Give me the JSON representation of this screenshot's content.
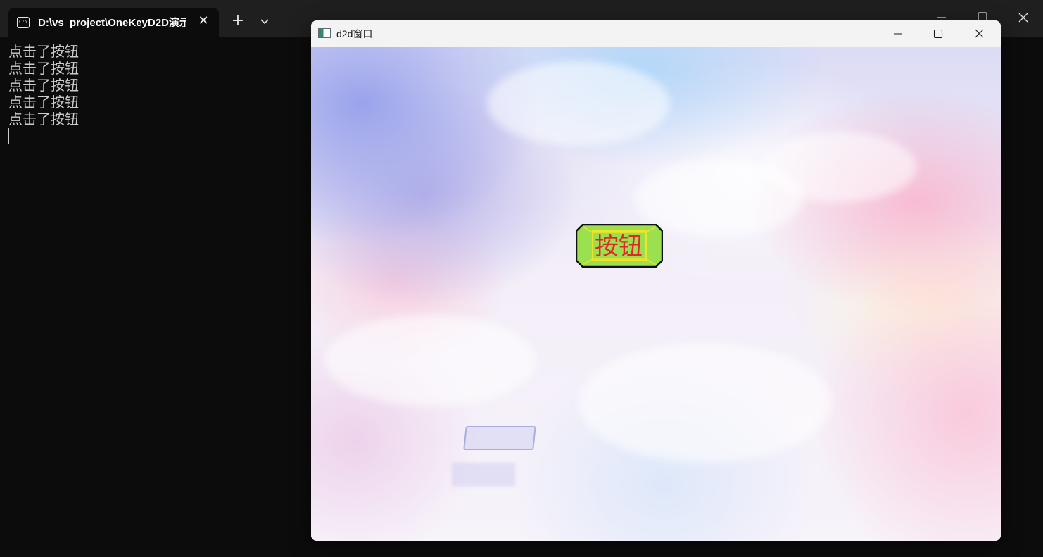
{
  "terminal": {
    "tab": {
      "title": "D:\\vs_project\\OneKeyD2D演示",
      "icon": "cmd-icon"
    },
    "new_tab_icon": "plus-icon",
    "dropdown_icon": "chevron-down-icon",
    "output_lines": [
      "点击了按钮",
      "点击了按钮",
      "点击了按钮",
      "点击了按钮",
      "点击了按钮"
    ]
  },
  "d2d_window": {
    "title": "d2d窗口",
    "button": {
      "label": "按钮",
      "fill_color": "#9be04f",
      "border_color": "#111111",
      "text_color": "#e02828",
      "focus_rect_color": "#f2e326"
    }
  }
}
